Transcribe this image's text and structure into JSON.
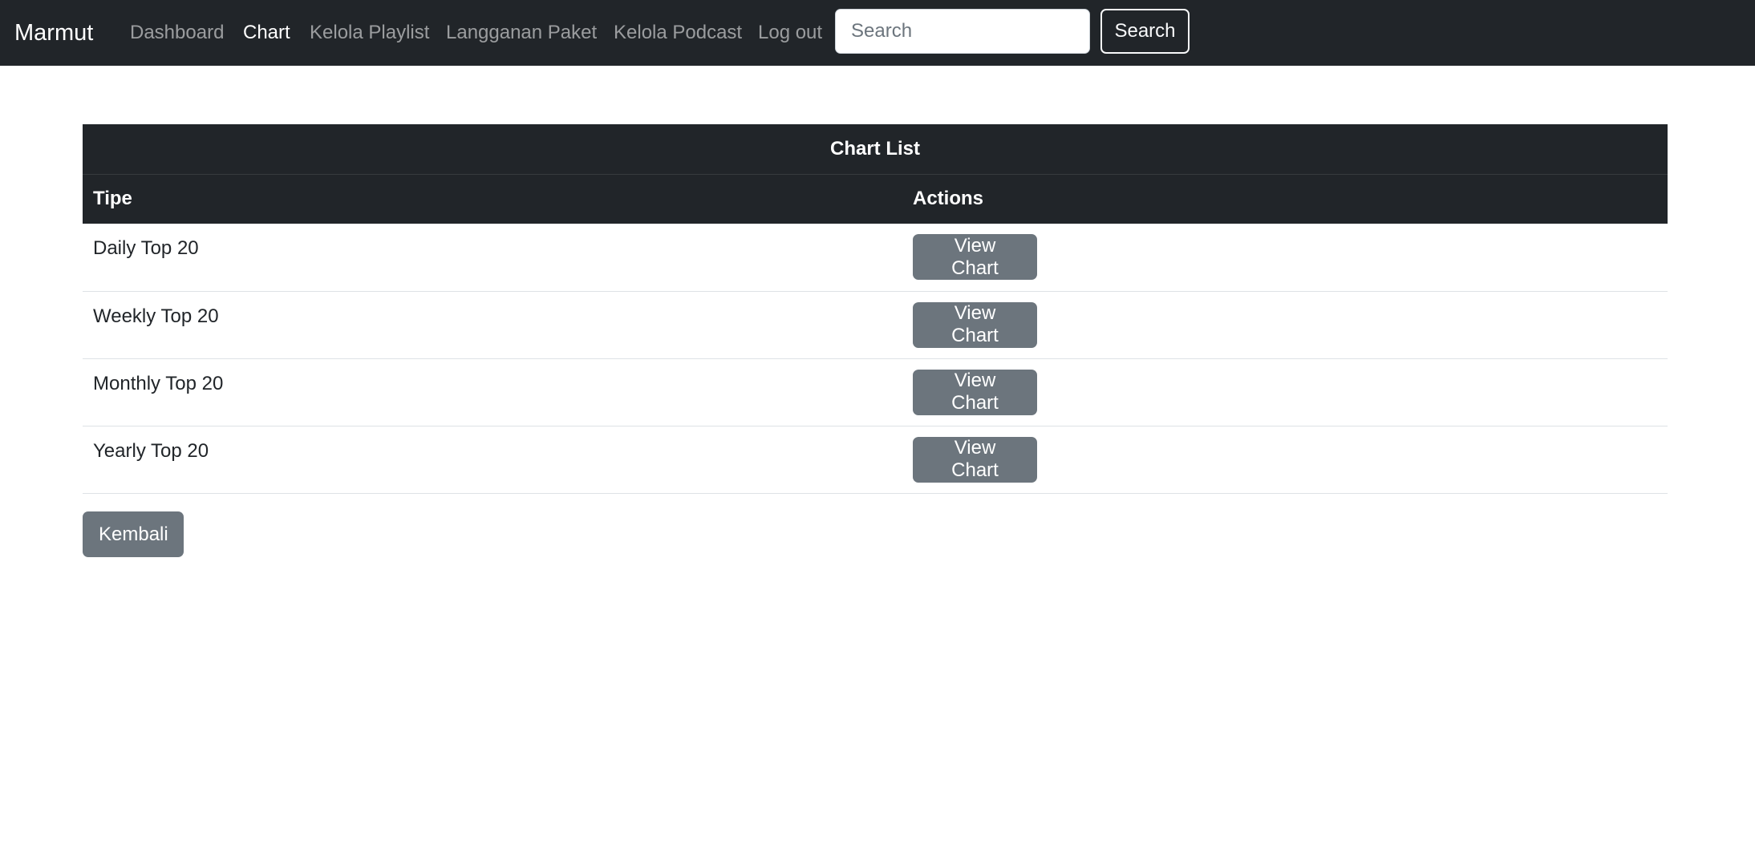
{
  "navbar": {
    "brand": "Marmut",
    "links": [
      {
        "label": "Dashboard",
        "active": false
      },
      {
        "label": "Chart",
        "active": true
      },
      {
        "label": "Kelola Playlist",
        "active": false
      },
      {
        "label": "Langganan Paket",
        "active": false
      },
      {
        "label": "Kelola Podcast",
        "active": false
      },
      {
        "label": "Log out",
        "active": false
      }
    ],
    "search": {
      "placeholder": "Search",
      "value": "",
      "button_label": "Search"
    }
  },
  "chart_table": {
    "title": "Chart List",
    "columns": [
      "Tipe",
      "Actions"
    ],
    "rows": [
      {
        "tipe": "Daily Top 20",
        "action_label": "View Chart"
      },
      {
        "tipe": "Weekly Top 20",
        "action_label": "View Chart"
      },
      {
        "tipe": "Monthly Top 20",
        "action_label": "View Chart"
      },
      {
        "tipe": "Yearly Top 20",
        "action_label": "View Chart"
      }
    ]
  },
  "back_button": {
    "label": "Kembali"
  },
  "colors": {
    "navbar_bg": "#212529",
    "button_secondary": "#6c757d",
    "nav_inactive": "rgba(255,255,255,0.55)",
    "nav_active": "#ffffff"
  }
}
